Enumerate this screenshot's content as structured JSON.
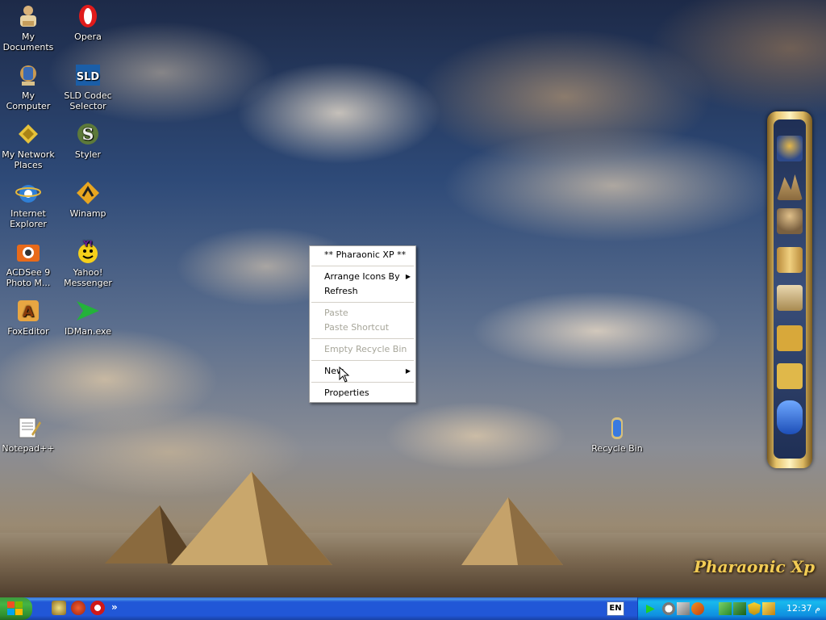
{
  "desktop": {
    "icons": [
      {
        "label": "My Documents",
        "icon": "my-documents-icon"
      },
      {
        "label": "Opera",
        "icon": "opera-icon"
      },
      {
        "label": "My Computer",
        "icon": "my-computer-icon"
      },
      {
        "label": "SLD Codec Selector",
        "icon": "codec-icon"
      },
      {
        "label": "My Network Places",
        "icon": "network-icon"
      },
      {
        "label": "Styler",
        "icon": "styler-icon"
      },
      {
        "label": "Internet Explorer",
        "icon": "ie-icon"
      },
      {
        "label": "Winamp",
        "icon": "winamp-icon"
      },
      {
        "label": "ACDSee 9 Photo M...",
        "icon": "acdsee-icon"
      },
      {
        "label": "Yahoo! Messenger",
        "icon": "yahoo-icon"
      },
      {
        "label": "FoxEditor",
        "icon": "foxeditor-icon"
      },
      {
        "label": "IDMan.exe",
        "icon": "idman-icon"
      },
      {
        "label": "Notepad++",
        "icon": "notepad-icon"
      },
      {
        "label": "Recycle Bin",
        "icon": "recycle-bin-icon"
      }
    ]
  },
  "context_menu": {
    "header": "** Pharaonic XP **",
    "arrange": "Arrange Icons By",
    "refresh": "Refresh",
    "paste": "Paste",
    "paste_shortcut": "Paste Shortcut",
    "empty_recycle": "Empty Recycle Bin",
    "new": "New",
    "properties": "Properties"
  },
  "branding": {
    "logo_text": "Pharaonic Xp"
  },
  "taskbar": {
    "language": "EN",
    "clock": "12:37 م"
  },
  "colors": {
    "taskbar": "#2157d7",
    "menu_highlight": "#316ac5",
    "start": "#3c9a3c",
    "tray": "#0f8fe0"
  }
}
